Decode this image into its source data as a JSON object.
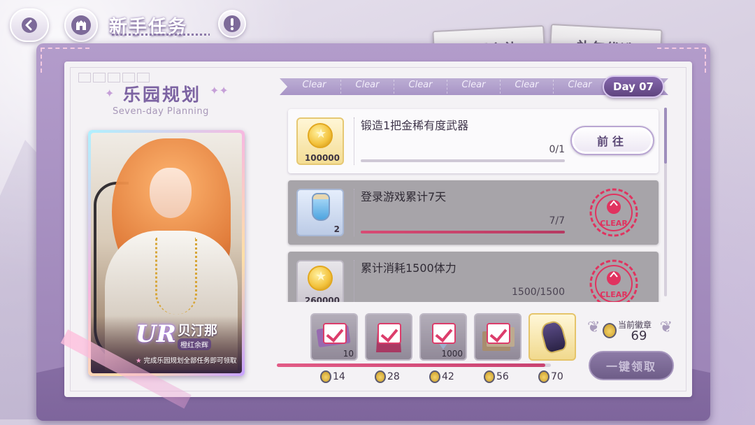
{
  "header": {
    "title": "新手任务",
    "back_icon": "chevron-left-icon",
    "home_icon": "castle-icon",
    "info_icon": "exclamation-icon"
  },
  "gift_tabs": [
    {
      "label": "初遇之礼"
    },
    {
      "label": "礼包优选"
    }
  ],
  "panel": {
    "title": "乐园规划",
    "subtitle": "Seven-day Planning"
  },
  "character": {
    "rarity": "UR",
    "name": "贝汀那",
    "epithet": "橙红余辉",
    "note": "完成乐园规划全部任务即可领取"
  },
  "days": {
    "completed": [
      "Clear",
      "Clear",
      "Clear",
      "Clear",
      "Clear",
      "Clear"
    ],
    "active": "Day 07"
  },
  "tasks": [
    {
      "name": "锻造1把金稀有度武器",
      "reward_icon": "gold-coin-icon",
      "reward_qty": "100000",
      "progress_text": "0/1",
      "progress": 0,
      "status": "open",
      "action_label": "前往"
    },
    {
      "name": "登录游戏累计7天",
      "reward_icon": "potion-bottle-icon",
      "reward_qty": "2",
      "progress_text": "7/7",
      "progress": 1,
      "status": "clear",
      "stamp_text": "CLEAR"
    },
    {
      "name": "累计消耗1500体力",
      "reward_icon": "gold-coin-icon",
      "reward_qty": "260000",
      "progress_text": "1500/1500",
      "progress": 1,
      "status": "clear",
      "stamp_text": "CLEAR"
    }
  ],
  "milestones": [
    {
      "icon": "ticket-icon",
      "qty": "10",
      "requirement": "14",
      "claimed": true
    },
    {
      "icon": "gift-bag-icon",
      "qty": "",
      "requirement": "28",
      "claimed": true
    },
    {
      "icon": "crystal-icon",
      "qty": "1000",
      "requirement": "42",
      "claimed": true
    },
    {
      "icon": "cards-icon",
      "qty": "",
      "requirement": "56",
      "claimed": true
    },
    {
      "icon": "helmet-icon",
      "qty": "",
      "requirement": "70",
      "claimed": false
    }
  ],
  "milestone_progress": 0.98,
  "badges": {
    "label": "当前徽章",
    "value": "69"
  },
  "claim_all_label": "一键领取",
  "colors": {
    "accent": "#7c63a2",
    "progress": "#c94372",
    "stamp": "#e0335f"
  }
}
